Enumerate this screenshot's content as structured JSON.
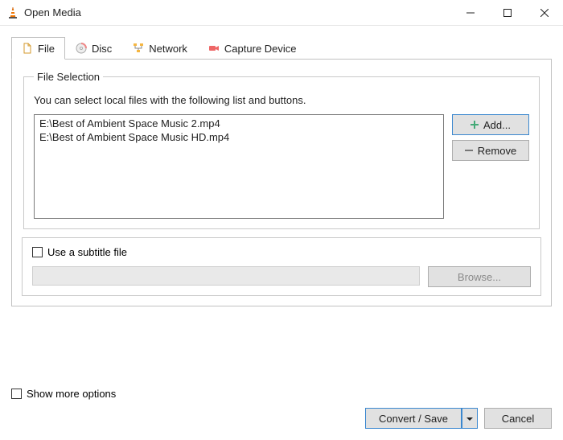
{
  "window": {
    "title": "Open Media"
  },
  "tabs": {
    "file": "File",
    "disc": "Disc",
    "network": "Network",
    "capture": "Capture Device"
  },
  "file_section": {
    "legend": "File Selection",
    "hint": "You can select local files with the following list and buttons.",
    "items": [
      "E:\\Best of Ambient Space Music 2.mp4",
      "E:\\Best of Ambient Space Music HD.mp4"
    ],
    "add_label": "Add...",
    "remove_label": "Remove"
  },
  "subtitle": {
    "checkbox_label": "Use a subtitle file",
    "browse_label": "Browse...",
    "checked": false
  },
  "more_options": {
    "label": "Show more options",
    "checked": false
  },
  "footer": {
    "convert_label": "Convert / Save",
    "cancel_label": "Cancel"
  }
}
